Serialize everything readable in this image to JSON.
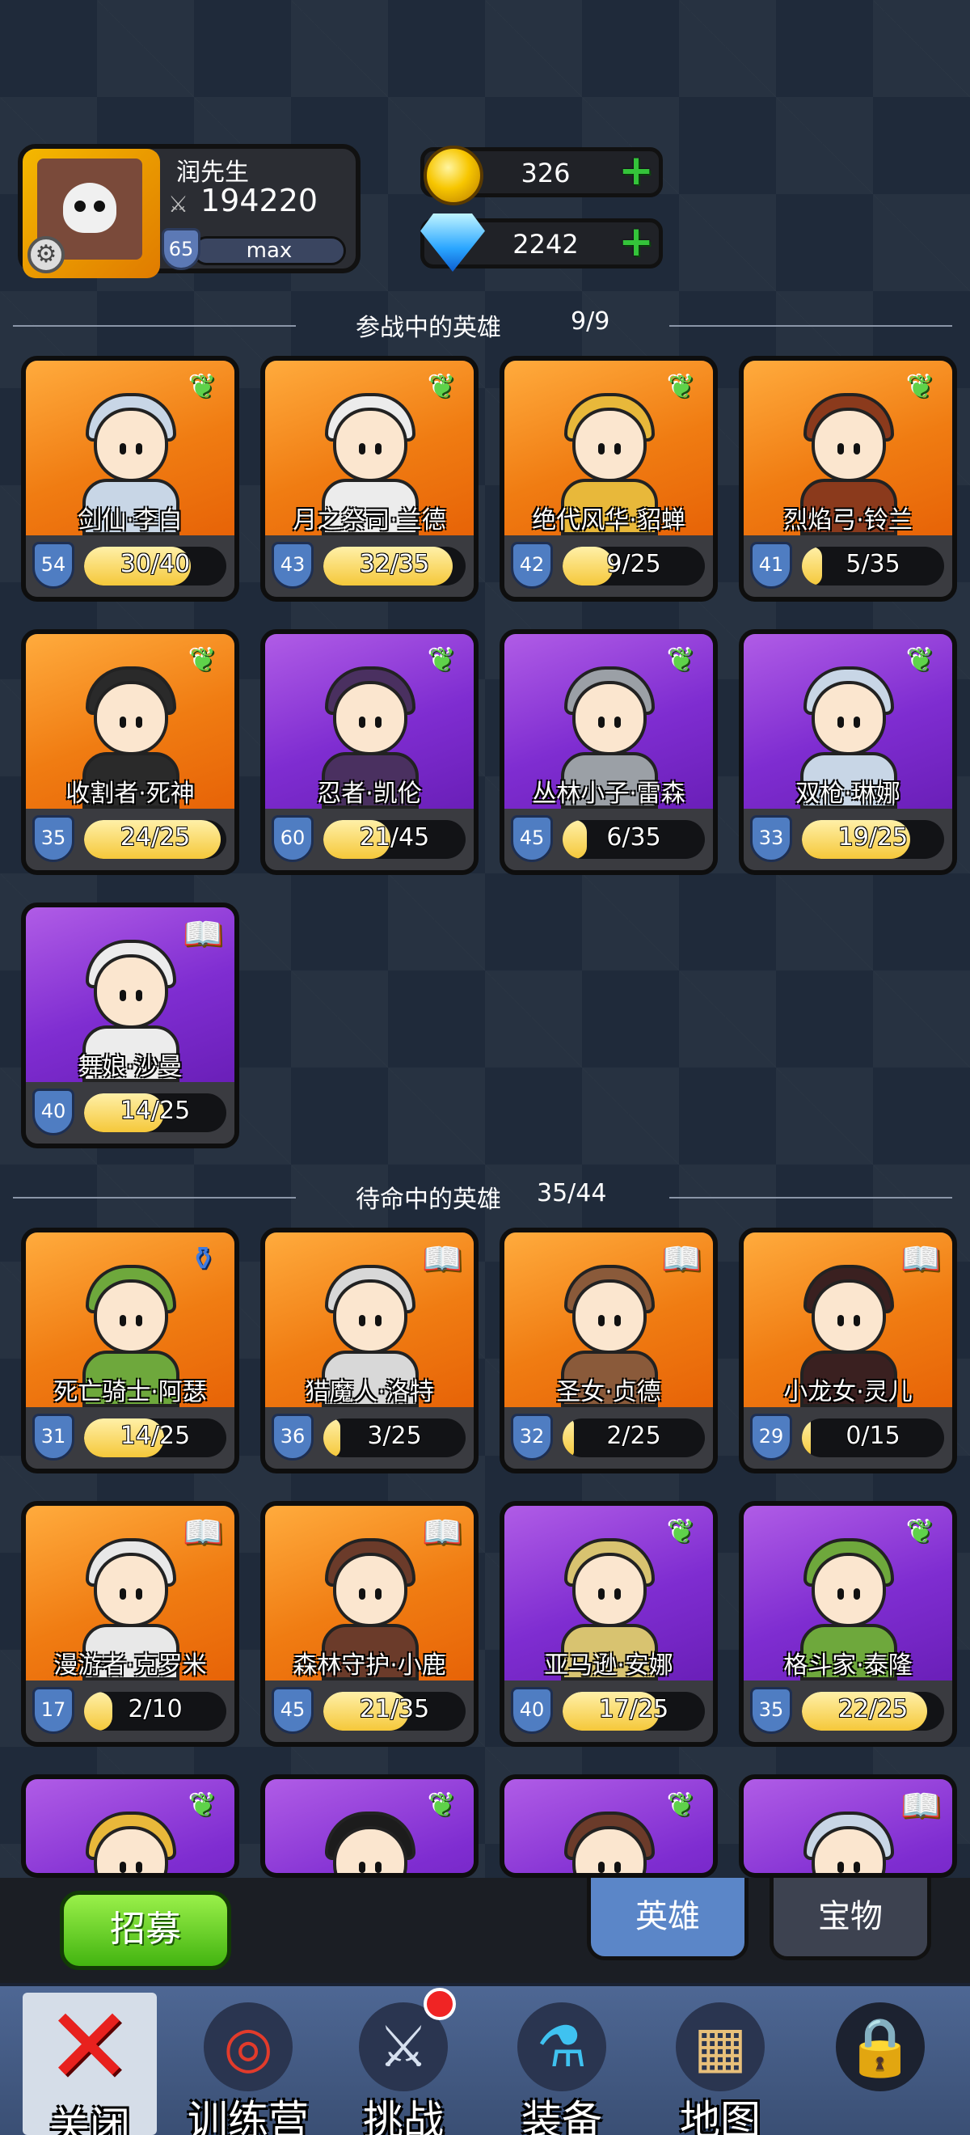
{
  "player": {
    "name": "润先生",
    "power": "194220",
    "level": "65",
    "xp_label": "max"
  },
  "currency": {
    "coins": "326",
    "gems": "2242"
  },
  "active_section": {
    "title": "参战中的英雄",
    "count": "9/9"
  },
  "standby_section": {
    "title": "待命中的英雄",
    "count": "35/44"
  },
  "active_heroes": [
    {
      "name": "剑仙·李白",
      "level": "54",
      "fragments": "30/40",
      "progress": 0.75,
      "frame": "orange",
      "badge": "wing-icon"
    },
    {
      "name": "月之祭司·兰德",
      "level": "43",
      "fragments": "32/35",
      "progress": 0.91,
      "frame": "orange",
      "badge": "wing-icon"
    },
    {
      "name": "绝代风华·貂蝉",
      "level": "42",
      "fragments": "9/25",
      "progress": 0.36,
      "frame": "orange",
      "badge": "wing-icon"
    },
    {
      "name": "烈焰弓·铃兰",
      "level": "41",
      "fragments": "5/35",
      "progress": 0.14,
      "frame": "orange",
      "badge": "wing-icon"
    },
    {
      "name": "收割者·死神",
      "level": "35",
      "fragments": "24/25",
      "progress": 0.96,
      "frame": "orange",
      "badge": "wing-icon"
    },
    {
      "name": "忍者·凯伦",
      "level": "60",
      "fragments": "21/45",
      "progress": 0.47,
      "frame": "purple",
      "badge": "wing-icon"
    },
    {
      "name": "丛林小子·雷森",
      "level": "45",
      "fragments": "6/35",
      "progress": 0.17,
      "frame": "purple",
      "badge": "wing-icon"
    },
    {
      "name": "双枪·琳娜",
      "level": "33",
      "fragments": "19/25",
      "progress": 0.76,
      "frame": "purple",
      "badge": "wing-icon"
    },
    {
      "name": "舞娘·沙曼",
      "level": "40",
      "fragments": "14/25",
      "progress": 0.56,
      "frame": "purple",
      "badge": "book-icon"
    }
  ],
  "standby_heroes": [
    {
      "name": "死亡骑士·阿瑟",
      "level": "31",
      "fragments": "14/25",
      "progress": 0.56,
      "frame": "orange",
      "badge": "potion-icon"
    },
    {
      "name": "猎魔人·洛特",
      "level": "36",
      "fragments": "3/25",
      "progress": 0.12,
      "frame": "orange",
      "badge": "book-icon"
    },
    {
      "name": "圣女·贞德",
      "level": "32",
      "fragments": "2/25",
      "progress": 0.08,
      "frame": "orange",
      "badge": "book-icon"
    },
    {
      "name": "小龙女·灵儿",
      "level": "29",
      "fragments": "0/15",
      "progress": 0.0,
      "frame": "orange",
      "badge": "book-icon"
    },
    {
      "name": "漫游者·克罗米",
      "level": "17",
      "fragments": "2/10",
      "progress": 0.2,
      "frame": "orange",
      "badge": "book-icon"
    },
    {
      "name": "森林守护·小鹿",
      "level": "45",
      "fragments": "21/35",
      "progress": 0.6,
      "frame": "orange",
      "badge": "book-icon"
    },
    {
      "name": "亚马逊·安娜",
      "level": "40",
      "fragments": "17/25",
      "progress": 0.68,
      "frame": "purple",
      "badge": "wing-icon"
    },
    {
      "name": "格斗家·泰隆",
      "level": "35",
      "fragments": "22/25",
      "progress": 0.88,
      "frame": "purple",
      "badge": "wing-icon"
    },
    {
      "name": "",
      "level": "",
      "fragments": "",
      "progress": 0,
      "frame": "purple",
      "badge": "wing-icon"
    },
    {
      "name": "",
      "level": "",
      "fragments": "",
      "progress": 0,
      "frame": "purple",
      "badge": "wing-icon"
    },
    {
      "name": "",
      "level": "",
      "fragments": "",
      "progress": 0,
      "frame": "purple",
      "badge": "wing-icon"
    },
    {
      "name": "",
      "level": "",
      "fragments": "",
      "progress": 0,
      "frame": "purple",
      "badge": "book-icon"
    }
  ],
  "actions": {
    "recruit_label": "招募",
    "tab_heroes": "英雄",
    "tab_treasure": "宝物"
  },
  "nav": {
    "close": "关闭",
    "training": "训练营",
    "challenge": "挑战",
    "equipment": "装备",
    "map": "地图"
  }
}
